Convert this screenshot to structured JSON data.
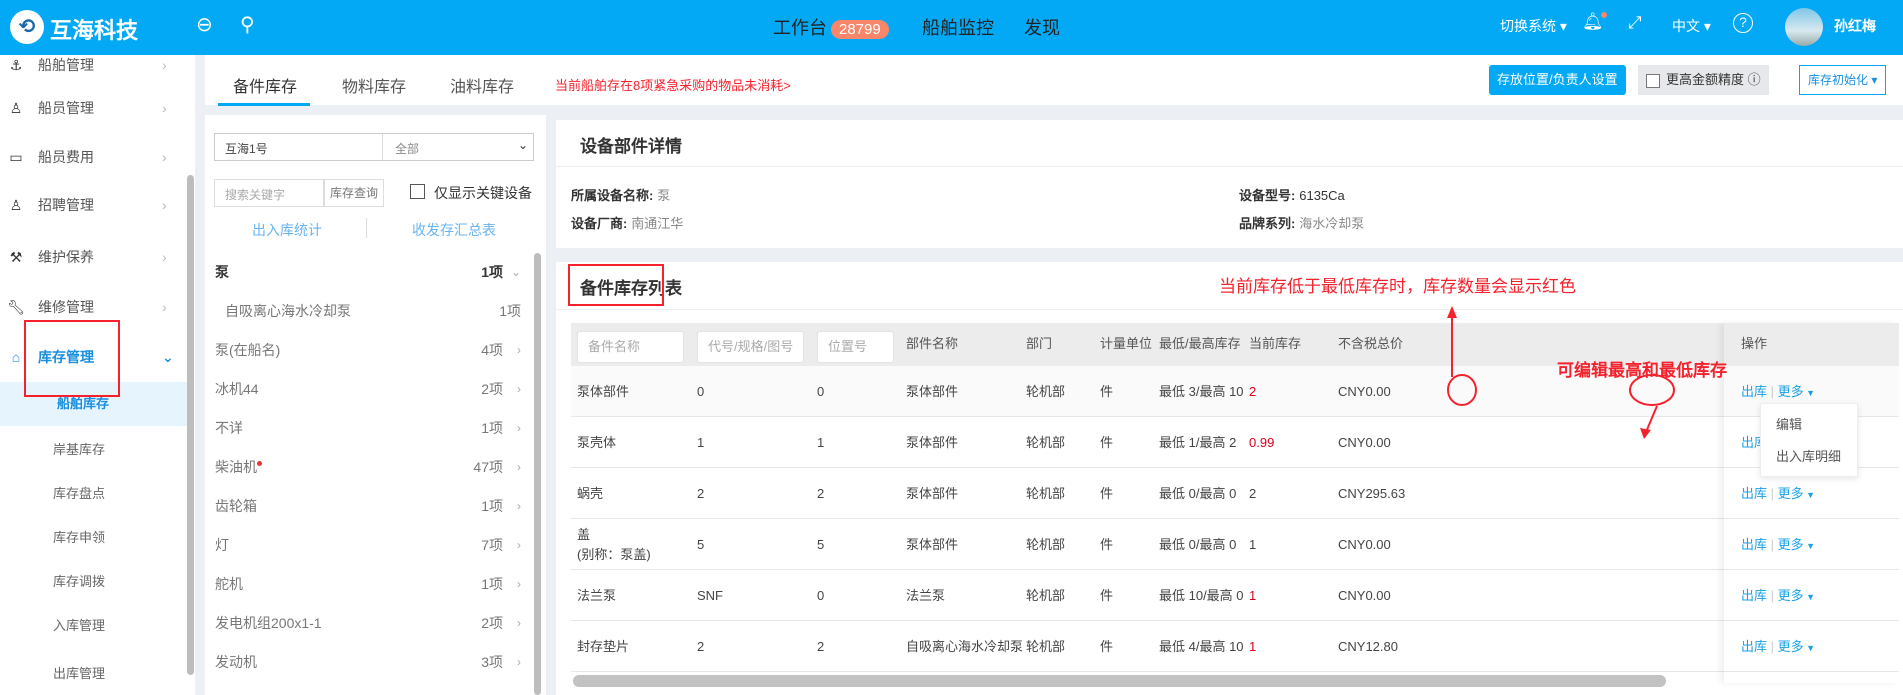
{
  "header": {
    "brand": "互海科技",
    "nav": [
      {
        "label": "工作台",
        "badge": "28799"
      },
      {
        "label": "船舶监控"
      },
      {
        "label": "发现"
      }
    ],
    "switch_system": "切换系统",
    "language": "中文",
    "user": "孙红梅",
    "accent": "#03a9f4"
  },
  "sidebar": {
    "items": [
      {
        "label": "船舶管理",
        "icon": "ship-icon"
      },
      {
        "label": "船员管理",
        "icon": "user-icon"
      },
      {
        "label": "船员费用",
        "icon": "wallet-icon"
      },
      {
        "label": "招聘管理",
        "icon": "user-add-icon"
      },
      {
        "label": "维护保养",
        "icon": "hammer-icon"
      },
      {
        "label": "维修管理",
        "icon": "wrench-icon"
      },
      {
        "label": "库存管理",
        "icon": "home-icon",
        "active": true
      }
    ],
    "sub_items": [
      {
        "label": "船舶库存",
        "active": true
      },
      {
        "label": "岸基库存"
      },
      {
        "label": "库存盘点"
      },
      {
        "label": "库存申领"
      },
      {
        "label": "库存调拨"
      },
      {
        "label": "入库管理"
      },
      {
        "label": "出库管理"
      }
    ]
  },
  "tabs": {
    "items": [
      "备件库存",
      "物料库存",
      "油料库存"
    ],
    "alert": "当前船舶存在8项紧急采购的物品未消耗>",
    "location_btn": "存放位置/负责人设置",
    "precision_label": "更高金额精度",
    "init_btn": "库存初始化"
  },
  "list": {
    "ship": "互海1号",
    "filter": "全部",
    "search_placeholder": "搜索关键字",
    "search_btn": "库存查询",
    "key_only": "仅显示关键设备",
    "link1": "出入库统计",
    "link2": "收发存汇总表",
    "items": [
      {
        "name": "泵",
        "count": "1项",
        "bold": true
      },
      {
        "name": "自吸离心海水冷却泵",
        "count": "1项",
        "child": true
      },
      {
        "name": "泵(在船名)",
        "count": "4项"
      },
      {
        "name": "冰机44",
        "count": "2项"
      },
      {
        "name": "不详",
        "count": "1项"
      },
      {
        "name": "柴油机",
        "count": "47项",
        "dot": true
      },
      {
        "name": "齿轮箱",
        "count": "1项"
      },
      {
        "name": "灯",
        "count": "7项"
      },
      {
        "name": "舵机",
        "count": "1项"
      },
      {
        "name": "发电机组200x1-1",
        "count": "2项"
      },
      {
        "name": "发动机",
        "count": "3项"
      }
    ]
  },
  "detail": {
    "title": "设备部件详情",
    "fields": [
      {
        "label": "所属设备名称:",
        "value": "泵"
      },
      {
        "label": "设备型号:",
        "value": "6135Ca"
      },
      {
        "label": "设备厂商:",
        "value": "南通江华"
      },
      {
        "label": "品牌系列:",
        "value": "海水冷却泵"
      }
    ]
  },
  "table": {
    "title": "备件库存列表",
    "filters": [
      "备件名称",
      "代号/规格/图号",
      "位置号"
    ],
    "headers": [
      "部件名称",
      "部门",
      "计量单位",
      "最低/最高库存",
      "当前库存",
      "不含税总价",
      "操作"
    ],
    "rows": [
      {
        "name": "泵体部件",
        "code": "0",
        "loc": "0",
        "part": "泵体部件",
        "dept": "轮机部",
        "unit": "件",
        "minmax": "最低 3/最高 10",
        "cur": "2",
        "low": true,
        "price": "CNY0.00"
      },
      {
        "name": "泵壳体",
        "code": "1",
        "loc": "1",
        "part": "泵体部件",
        "dept": "轮机部",
        "unit": "件",
        "minmax": "最低 1/最高 2",
        "cur": "0.99",
        "low": true,
        "price": "CNY0.00"
      },
      {
        "name": "蜗壳",
        "code": "2",
        "loc": "2",
        "part": "泵体部件",
        "dept": "轮机部",
        "unit": "件",
        "minmax": "最低 0/最高 0",
        "cur": "2",
        "low": false,
        "price": "CNY295.63"
      },
      {
        "name": "盖",
        "alias": "(别称：泵盖)",
        "code": "5",
        "loc": "5",
        "part": "泵体部件",
        "dept": "轮机部",
        "unit": "件",
        "minmax": "最低 0/最高 0",
        "cur": "1",
        "low": false,
        "price": "CNY0.00"
      },
      {
        "name": "法兰泵",
        "code": "SNF",
        "loc": "0",
        "part": "法兰泵",
        "dept": "轮机部",
        "unit": "件",
        "minmax": "最低 10/最高 0",
        "cur": "1",
        "low": true,
        "price": "CNY0.00"
      },
      {
        "name": "封存垫片",
        "code": "2",
        "loc": "2",
        "part": "自吸离心海水冷却泵",
        "dept": "轮机部",
        "unit": "件",
        "minmax": "最低 4/最高 10",
        "cur": "1",
        "low": true,
        "price": "CNY12.80"
      }
    ],
    "op_out": "出库",
    "op_more": "更多",
    "menu": [
      "编辑",
      "出入库明细"
    ]
  },
  "annotations": {
    "low_stock": "当前库存低于最低库存时，库存数量会显示红色",
    "editable": "可编辑最高和最低库存"
  }
}
